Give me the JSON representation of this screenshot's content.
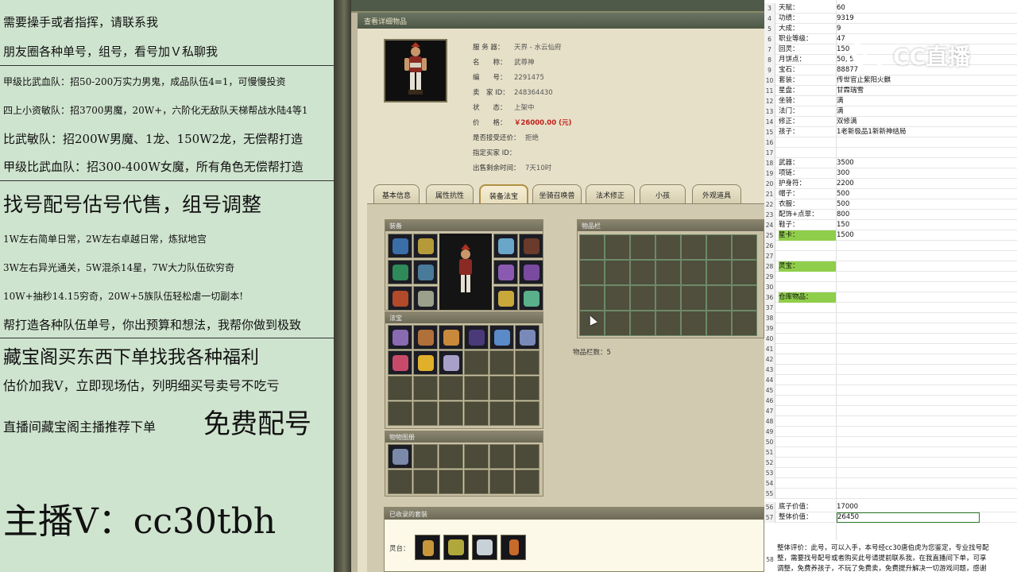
{
  "promo": {
    "lines": [
      "需要操手或者指挥，请联系我",
      "朋友圈各种单号，组号，看号加Ｖ私聊我",
      "甲级比武血队：招50-200万实力男鬼，成品队伍4=1，可慢慢投资",
      "四上小资敏队：招3700男魔，20W+，六阶化无敌队天梯帮战水陆4等1",
      "比武敏队：招200W男魔、1龙、150W2龙，无偿帮打造",
      "甲级比武血队：招300-400W女魔，所有角色无偿帮打造",
      "找号配号估号代售，组号调整",
      "1W左右简单日常，2W左右卓越日常，炼狱地宫",
      "3W左右异光通关，5W混杀14星，7W大力队伍砍穷奇",
      "10W+抽秒14.15穷奇，20W+5族队伍轻松虐一切副本!",
      "帮打造各种队伍单号，你出预算和想法，我帮你做到极致",
      "藏宝阁买东西下单找我各种福利",
      "估价加我V，立即现场估，列明细买号卖号不吃亏",
      "直播间藏宝阁主播推荐下单",
      "免费配号",
      "主播V：cc30tbh"
    ]
  },
  "game": {
    "header_title": "查看详细物品",
    "info": [
      {
        "key": "服 务 器：",
        "value": "天界 - 水云仙府"
      },
      {
        "key": "名　　称：",
        "value": "武尊神"
      },
      {
        "key": "编　　号：",
        "value": "2291475"
      },
      {
        "key": "卖　家 ID：",
        "value": "248364430"
      },
      {
        "key": "状　　态：",
        "value": "上架中"
      },
      {
        "key": "价　　格：",
        "value": "￥26000.00 (元)"
      },
      {
        "key": "是否接受还价：",
        "value": "拒绝"
      },
      {
        "key": "指定买家 ID：",
        "value": ""
      },
      {
        "key": "出售剩余时间：",
        "value": "7天10时"
      }
    ],
    "tabs": [
      "基本信息",
      "属性抗性",
      "装备法宝",
      "坐骑召唤兽",
      "法术修正",
      "小孩",
      "外观道具"
    ],
    "active_tab": "装备法宝",
    "equip_title": "装备",
    "fabao_title": "法宝",
    "tuzhi_title": "物物图册",
    "bag_title": "物品栏",
    "item_count": "物品栏数：5",
    "suit_title": "已收录的套装",
    "lingtai_label": "灵台："
  },
  "sheet": {
    "rows": [
      {
        "n": "3",
        "a": "天赋：",
        "b": "60"
      },
      {
        "n": "4",
        "a": "功绩：",
        "b": "9319"
      },
      {
        "n": "5",
        "a": "大成：",
        "b": "9"
      },
      {
        "n": "6",
        "a": "职业等级：",
        "b": "47"
      },
      {
        "n": "7",
        "a": "回灵：",
        "b": "150"
      },
      {
        "n": "8",
        "a": "月饼点：",
        "b": "50, 5"
      },
      {
        "n": "9",
        "a": "宝石：",
        "b": "88877"
      },
      {
        "n": "10",
        "a": "套装：",
        "b": "传世官止紫阳火麒"
      },
      {
        "n": "11",
        "a": "星盘：",
        "b": "甘霖瑞雪"
      },
      {
        "n": "12",
        "a": "坐骑：",
        "b": "满"
      },
      {
        "n": "13",
        "a": "法门：",
        "b": "满"
      },
      {
        "n": "14",
        "a": "修正：",
        "b": "双修满"
      },
      {
        "n": "15",
        "a": "孩子：",
        "b": "1老新极品1新新神结局"
      },
      {
        "n": "16",
        "a": "",
        "b": ""
      },
      {
        "n": "17",
        "a": "",
        "b": ""
      },
      {
        "n": "18",
        "a": "武器：",
        "b": "3500"
      },
      {
        "n": "19",
        "a": "项链：",
        "b": "300"
      },
      {
        "n": "20",
        "a": "护身符：",
        "b": "2200"
      },
      {
        "n": "21",
        "a": "帽子：",
        "b": "500"
      },
      {
        "n": "22",
        "a": "衣服：",
        "b": "500"
      },
      {
        "n": "23",
        "a": "配饰+点翠：",
        "b": "800"
      },
      {
        "n": "24",
        "a": "鞋子：",
        "b": "150"
      },
      {
        "n": "25",
        "a": "星卡：",
        "b": "1500",
        "green": true
      },
      {
        "n": "26",
        "a": "",
        "b": ""
      },
      {
        "n": "27",
        "a": "",
        "b": ""
      },
      {
        "n": "28",
        "a": "灵宝：",
        "b": "",
        "green": true
      },
      {
        "n": "29",
        "a": "",
        "b": ""
      },
      {
        "n": "30",
        "a": "",
        "b": ""
      },
      {
        "n": "36",
        "a": "仓库物品：",
        "b": "",
        "green": true
      },
      {
        "n": "37",
        "a": "",
        "b": ""
      },
      {
        "n": "38",
        "a": "",
        "b": ""
      },
      {
        "n": "39",
        "a": "",
        "b": ""
      },
      {
        "n": "40",
        "a": "",
        "b": ""
      },
      {
        "n": "41",
        "a": "",
        "b": ""
      },
      {
        "n": "42",
        "a": "",
        "b": ""
      },
      {
        "n": "43",
        "a": "",
        "b": ""
      },
      {
        "n": "44",
        "a": "",
        "b": ""
      },
      {
        "n": "45",
        "a": "",
        "b": ""
      },
      {
        "n": "46",
        "a": "",
        "b": ""
      },
      {
        "n": "47",
        "a": "",
        "b": ""
      },
      {
        "n": "48",
        "a": "",
        "b": ""
      },
      {
        "n": "49",
        "a": "",
        "b": ""
      },
      {
        "n": "50",
        "a": "",
        "b": ""
      },
      {
        "n": "51",
        "a": "",
        "b": ""
      },
      {
        "n": "52",
        "a": "",
        "b": ""
      },
      {
        "n": "53",
        "a": "",
        "b": ""
      },
      {
        "n": "54",
        "a": "",
        "b": ""
      },
      {
        "n": "55",
        "a": "",
        "b": ""
      },
      {
        "n": "56",
        "a": "底子价值：",
        "b": "17000"
      },
      {
        "n": "57",
        "a": "整体价值：",
        "b": "26450",
        "selected": true
      }
    ],
    "eval_rownum": "58",
    "eval_lines": [
      "整体评价：此号，可以入手，本号经cc30唐伯虎为您鉴定，专业找号配",
      "整，需要找号配号或者购买此号请提前联系我，在我直播间下单，可享",
      "调整，免费养孩子，不玩了免费卖，免费提升解决一切游戏问题，感谢"
    ]
  },
  "watermark": {
    "text": "CC直播"
  },
  "colors": {
    "promo_bg": "#cfe4cf",
    "price_red": "#c0201a",
    "sheet_green": "#8fce4a"
  }
}
